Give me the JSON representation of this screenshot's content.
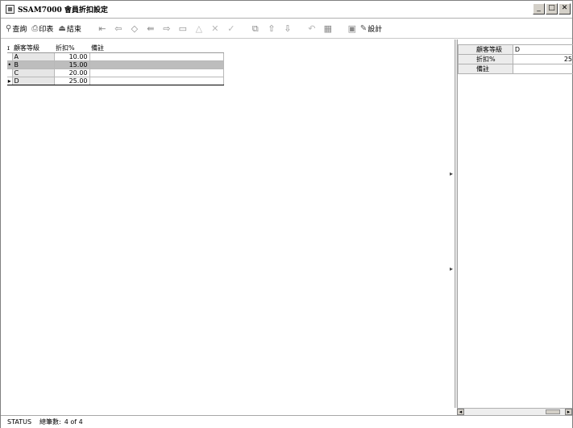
{
  "window": {
    "title": "SSAM7000 會員折扣設定",
    "minimize_glyph": "_",
    "maximize_glyph": "□",
    "close_glyph": "✕"
  },
  "toolbar": {
    "query_label": "查詢",
    "print_label": "印表",
    "exit_label": "結束",
    "design_label": "設計",
    "icons": [
      "first-icon",
      "prev-page-icon",
      "prev-icon",
      "next-icon",
      "last-icon",
      "minus-icon",
      "triangle-icon",
      "cancel-icon",
      "confirm-icon",
      "copy-icon",
      "insert-above-icon",
      "insert-below-icon",
      "undo-icon",
      "grid-icon",
      "image-icon",
      "design-icon"
    ]
  },
  "grid": {
    "columns": [
      "顧客等級",
      "折扣%",
      "備註"
    ],
    "rows": [
      {
        "grade": "A",
        "discount": "10.00",
        "note": ""
      },
      {
        "grade": "B",
        "discount": "15.00",
        "note": ""
      },
      {
        "grade": "C",
        "discount": "20.00",
        "note": ""
      },
      {
        "grade": "D",
        "discount": "25.00",
        "note": ""
      }
    ],
    "selected_row": 1,
    "current_row": 3
  },
  "detail": {
    "fields": [
      {
        "label": "顧客等級",
        "value": "D"
      },
      {
        "label": "折扣%",
        "value": "25"
      },
      {
        "label": "備註",
        "value": ""
      }
    ]
  },
  "status": {
    "status_label": "STATUS",
    "count_label": "總筆數:",
    "count_value": "4 of 4"
  },
  "colors": {
    "selected_row": "#bdbdbd",
    "grade_column": "#e6e6e6"
  }
}
